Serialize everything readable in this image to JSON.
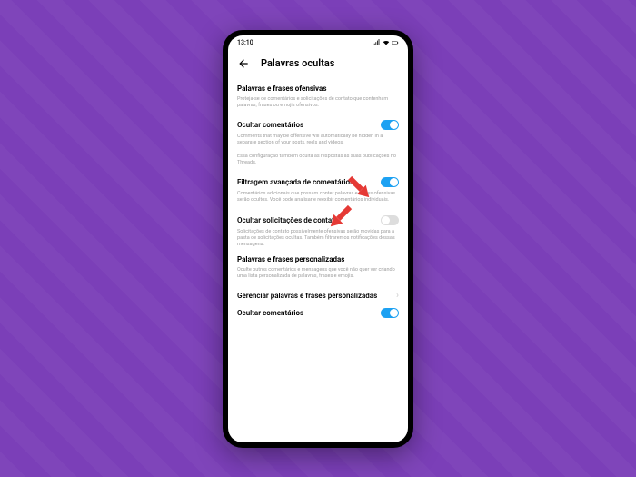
{
  "statusbar": {
    "time": "13:10"
  },
  "header": {
    "title": "Palavras ocultas"
  },
  "section1": {
    "title": "Palavras e frases ofensivas",
    "desc": "Proteja-se de comentários e solicitações de contato que contenham palavras, frases ou emojis ofensivos."
  },
  "row1": {
    "label": "Ocultar comentários",
    "desc": "Comments that may be offensive will automatically be hidden in a separate section of your posts, reels and videos.",
    "desc2": "Essa configuração também oculta as respostas às suas publicações no Threads."
  },
  "row2": {
    "label": "Filtragem avançada de comentários",
    "desc": "Comentários adicionais que possam conter palavras e frases ofensivas serão ocultos. Você pode analisar e reexibir comentários individuais."
  },
  "row3": {
    "label": "Ocultar solicitações de contato",
    "desc": "Solicitações de contato possivelmente ofensivas serão movidas para a pasta de solicitações ocultas. Também filtraremos notificações dessas mensagens."
  },
  "section2": {
    "title": "Palavras e frases personalizadas",
    "desc": "Oculte outros comentários e mensagens que você não quer ver criando uma lista personalizada de palavras, frases e emojis."
  },
  "row4": {
    "label": "Gerenciar palavras e frases personalizadas"
  },
  "row5": {
    "label": "Ocultar comentários"
  }
}
